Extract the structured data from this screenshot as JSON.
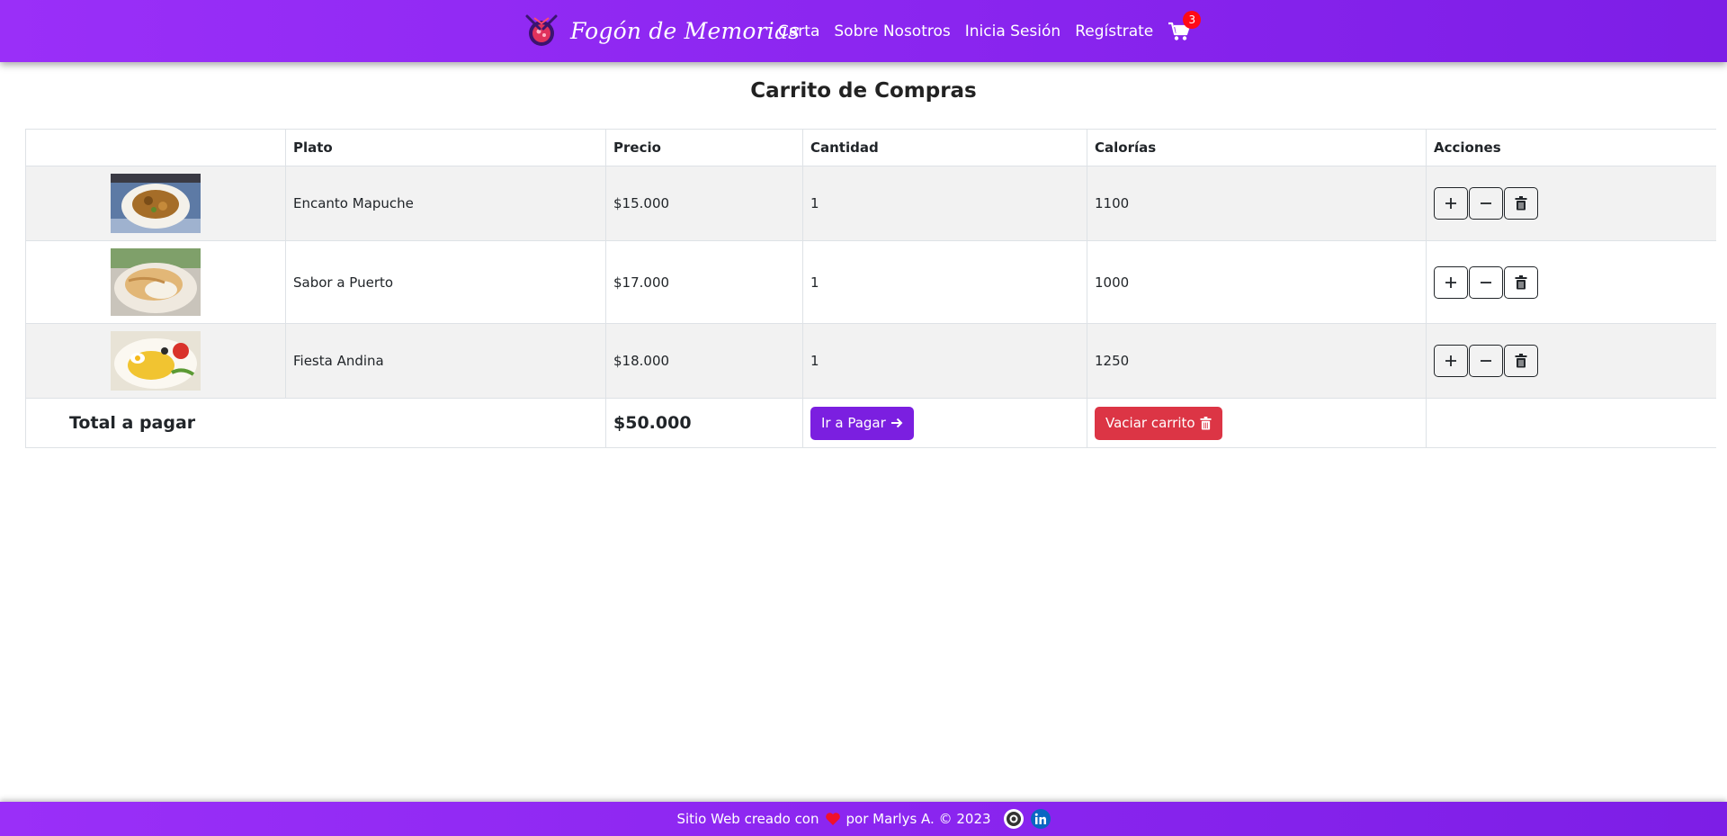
{
  "brand": {
    "name": "Fogón de Memorias"
  },
  "nav": {
    "links": [
      "Carta",
      "Sobre Nosotros",
      "Inicia Sesión",
      "Regístrate"
    ],
    "cart_count": "3"
  },
  "page": {
    "title": "Carrito de Compras"
  },
  "table": {
    "headers": [
      "",
      "Plato",
      "Precio",
      "Cantidad",
      "Calorías",
      "Acciones"
    ],
    "rows": [
      {
        "name": "Encanto Mapuche",
        "price": "$15.000",
        "qty": "1",
        "calories": "1100",
        "image_alt": "plato Encanto Mapuche"
      },
      {
        "name": "Sabor a Puerto",
        "price": "$17.000",
        "qty": "1",
        "calories": "1000",
        "image_alt": "plato Sabor a Puerto"
      },
      {
        "name": "Fiesta Andina",
        "price": "$18.000",
        "qty": "1",
        "calories": "1250",
        "image_alt": "plato Fiesta Andina"
      }
    ],
    "total_label": "Total a pagar",
    "total_value": "$50.000",
    "pay_label": "Ir a Pagar",
    "empty_label": "Vaciar carrito"
  },
  "footer": {
    "text_before": "Sitio Web creado con",
    "text_after": "por Marlys A. © 2023"
  },
  "colors": {
    "primary": "#8a25ef",
    "pay_button": "#7b1fe0",
    "danger": "#dc3545",
    "badge": "#ff0a16",
    "stripe": "#f2f2f2"
  },
  "icons": [
    "logo-icon",
    "cart-icon",
    "plus-icon",
    "minus-icon",
    "trash-icon",
    "arrow-right-icon",
    "heart-icon",
    "github-icon",
    "linkedin-icon"
  ]
}
